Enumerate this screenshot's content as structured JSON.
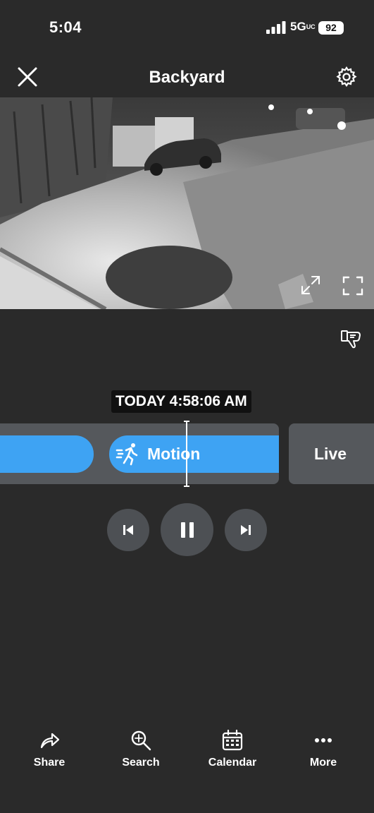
{
  "status_bar": {
    "time": "5:04",
    "network": "5G",
    "network_suffix": "UC",
    "battery": "92"
  },
  "header": {
    "title": "Backyard"
  },
  "player": {
    "timestamp": "TODAY 4:58:06 AM"
  },
  "timeline": {
    "event_label": "Motion",
    "live_label": "Live"
  },
  "icons": {
    "close": "close-icon",
    "settings": "gear-icon",
    "expand": "expand-icon",
    "fullscreen": "fullscreen-icon",
    "feedback": "thumbs-down-feedback-icon",
    "motion": "running-person-icon",
    "skip_back": "skip-previous-icon",
    "pause": "pause-icon",
    "skip_forward": "skip-next-icon"
  },
  "colors": {
    "accent": "#3ea3f3",
    "background": "#2a2a2a",
    "track": "#55585c"
  },
  "nav": {
    "share": "Share",
    "search": "Search",
    "calendar": "Calendar",
    "more": "More"
  }
}
